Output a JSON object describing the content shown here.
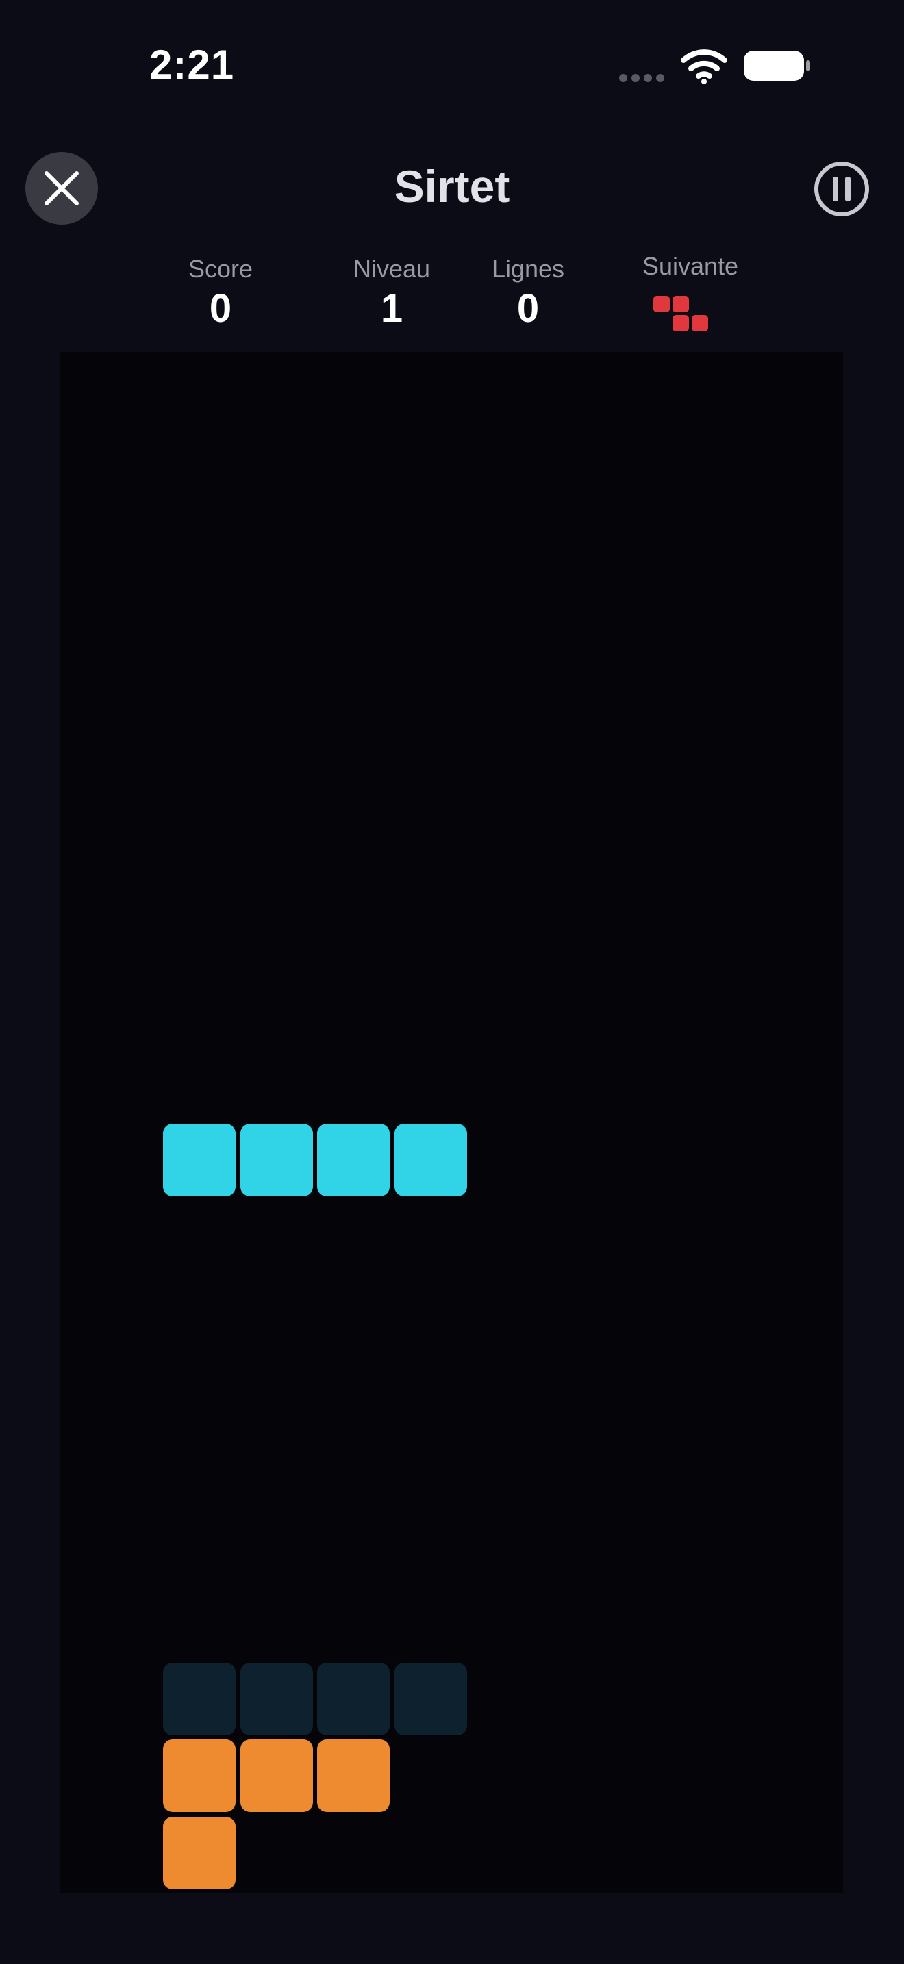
{
  "status_bar": {
    "time": "2:21"
  },
  "header": {
    "title": "Sirtet",
    "close_icon": "close-icon",
    "pause_icon": "pause-icon"
  },
  "stats": {
    "score_label": "Score",
    "score_value": "0",
    "level_label": "Niveau",
    "level_value": "1",
    "lines_label": "Lignes",
    "lines_value": "0",
    "next_label": "Suivante"
  },
  "next_piece": {
    "type": "Z",
    "color": "#e0383c",
    "cells": [
      [
        0,
        0
      ],
      [
        1,
        0
      ],
      [
        1,
        1
      ],
      [
        2,
        1
      ]
    ]
  },
  "board": {
    "columns": 10,
    "rows": 20,
    "active_piece": {
      "type": "I",
      "color": "#31d4e6",
      "cells": [
        [
          3,
          10
        ],
        [
          4,
          10
        ],
        [
          5,
          10
        ],
        [
          6,
          10
        ]
      ]
    },
    "ghost_piece": {
      "color": "#0e212e",
      "cells": [
        [
          3,
          17
        ],
        [
          4,
          17
        ],
        [
          5,
          17
        ],
        [
          6,
          17
        ]
      ]
    },
    "locked_cells": {
      "color": "#ee8a2f",
      "cells": [
        [
          3,
          18
        ],
        [
          4,
          18
        ],
        [
          5,
          18
        ],
        [
          3,
          19
        ]
      ]
    }
  },
  "colors": {
    "background": "#0c0c16",
    "board": "#050509",
    "accent_cyan": "#31d4e6",
    "accent_orange": "#ee8a2f",
    "accent_red": "#e0383c"
  }
}
